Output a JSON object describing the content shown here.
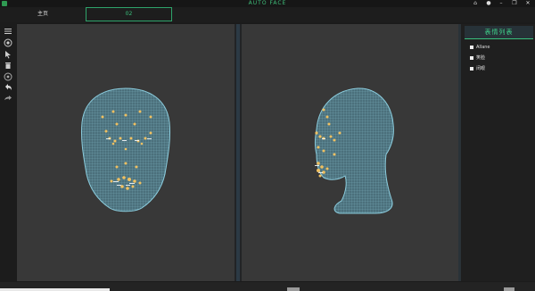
{
  "app": {
    "title": "AUTO FACE"
  },
  "window_controls": {
    "home": "⌂",
    "user": "●",
    "minimize": "–",
    "maximize": "❐",
    "close": "✕"
  },
  "tabs": [
    {
      "label": "主页"
    },
    {
      "label": "02"
    }
  ],
  "toolbar": {
    "tools": [
      "menu-icon",
      "target-icon",
      "pointer-icon",
      "trash-icon",
      "record-icon",
      "undo-icon",
      "redo-icon"
    ]
  },
  "panel": {
    "header": "表情列表",
    "items": [
      {
        "label": "Allane"
      },
      {
        "label": "笑脸"
      },
      {
        "label": "闭眼"
      }
    ]
  },
  "colors": {
    "accent": "#39c07d",
    "mesh": "#8fd4e6",
    "marker": "#f0c060"
  }
}
